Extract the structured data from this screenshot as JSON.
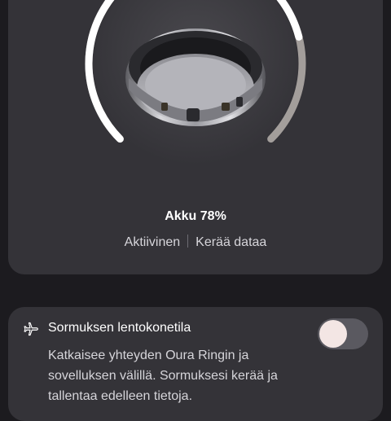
{
  "ring": {
    "battery_label": "Akku 78%",
    "battery_level": 0.78,
    "status_active": "Aktiivinen",
    "status_action": "Kerää dataa"
  },
  "airplane_mode": {
    "title": "Sormuksen lentokonetila",
    "description": "Katkaisee yhteyden Oura Ringin ja sovelluksen välillä. Sormuksesi kerää ja tallentaa edelleen tietoja.",
    "enabled": false
  },
  "colors": {
    "background": "#1c1b1f",
    "card": "#343338",
    "gauge_fill": "#ffffff",
    "gauge_track": "#a39e9b"
  }
}
